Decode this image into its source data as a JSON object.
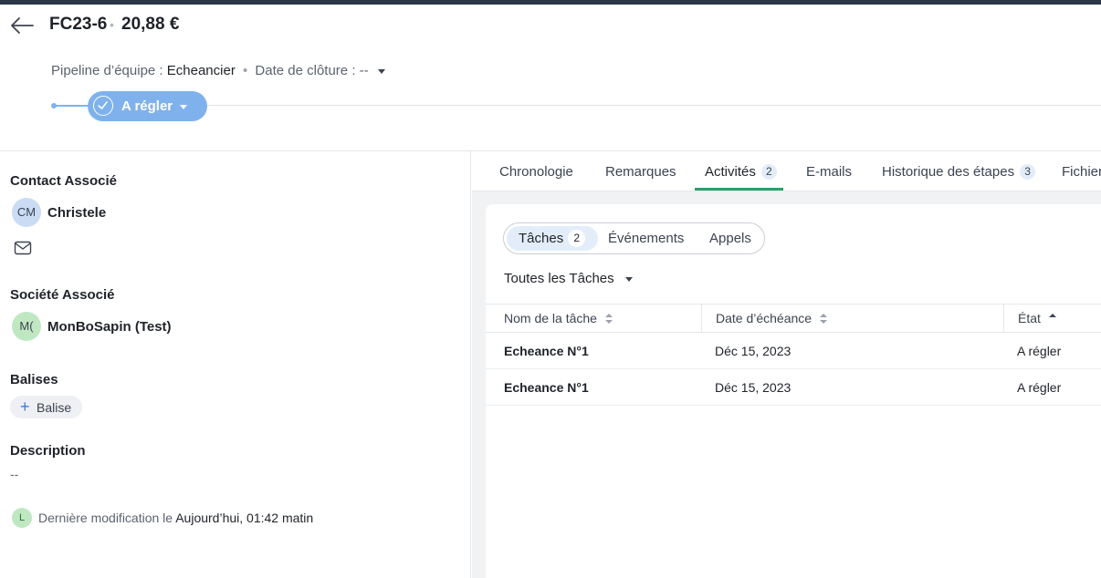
{
  "header": {
    "title": "FC23-6",
    "amount": "20,88 €",
    "pipeline_label": "Pipeline d’équipe :",
    "pipeline_value": "Echeancier",
    "close_date_label": "Date de clôture :",
    "close_date_value": "--",
    "stage": "A régler"
  },
  "left": {
    "contact_title": "Contact Associé",
    "contact_initials": "CM",
    "contact_name": "Christele",
    "company_title": "Société Associé",
    "company_initials": "M(",
    "company_name": "MonBoSapin (Test)",
    "tags_title": "Balises",
    "tag_button": "Balise",
    "description_title": "Description",
    "description_value": "--",
    "modified_avatar": "L",
    "modified_label": "Dernière modification le",
    "modified_value": "Aujourd’hui, 01:42 matin"
  },
  "tabs": [
    {
      "label": "Chronologie"
    },
    {
      "label": "Remarques"
    },
    {
      "label": "Activités",
      "count": "2"
    },
    {
      "label": "E-mails"
    },
    {
      "label": "Historique des étapes",
      "count": "3"
    },
    {
      "label": "Fichiers"
    }
  ],
  "activities": {
    "segments": [
      {
        "label": "Tâches",
        "count": "2"
      },
      {
        "label": "Événements"
      },
      {
        "label": "Appels"
      }
    ],
    "filter": "Toutes les Tâches",
    "columns": [
      "Nom de la tâche",
      "Date d’échéance",
      "État"
    ],
    "rows": [
      {
        "name": "Echeance N°1",
        "due": "Déc 15, 2023",
        "state": "A régler"
      },
      {
        "name": "Echeance N°1",
        "due": "Déc 15, 2023",
        "state": "A régler"
      }
    ]
  },
  "colors": {
    "accent": "#7fb2ec",
    "active_tab": "#2e9e6b",
    "highlight": "#ffff00"
  }
}
